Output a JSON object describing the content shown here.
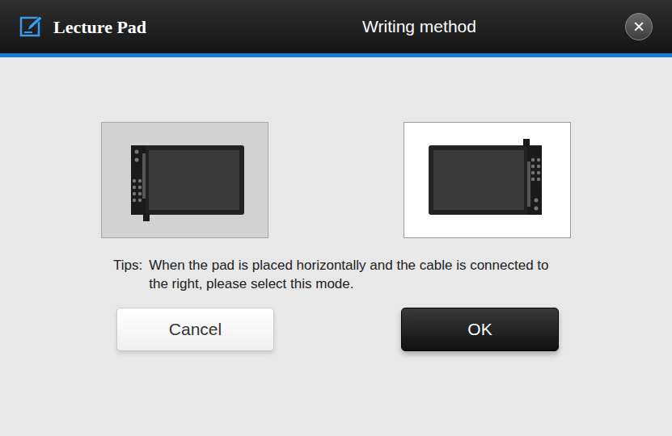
{
  "window": {
    "app_name": "Lecture Pad",
    "title": "Writing method",
    "close": "×"
  },
  "modes": [
    {
      "cable_side": "left",
      "selected": false
    },
    {
      "cable_side": "right",
      "selected": true
    }
  ],
  "tips": {
    "label": "Tips:",
    "text": "When the pad is placed horizontally and the cable is connected to the right, please select this mode."
  },
  "buttons": [
    {
      "label": "Cancel",
      "primary": false
    },
    {
      "label": "OK",
      "primary": true
    }
  ]
}
